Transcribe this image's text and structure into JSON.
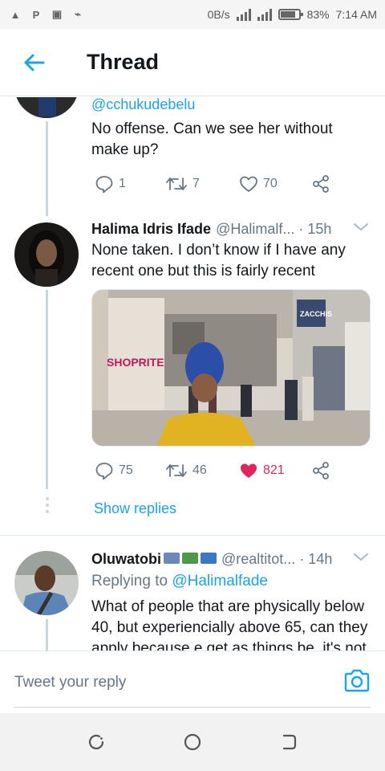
{
  "status_bar": {
    "speed": "0B/s",
    "battery": "83%",
    "time": "7:14 AM"
  },
  "header": {
    "title": "Thread"
  },
  "tweets": [
    {
      "username_link": "@cchukudebelu",
      "text": "No offense. Can we see her without make up?",
      "replies": "1",
      "retweets": "7",
      "likes": "70"
    },
    {
      "name": "Halima Idris Ifade",
      "handle": "@Halimalf...",
      "time": "· 15h",
      "text": "None taken. I don’t know if I have any recent one but this is fairly recent",
      "media_caption": "SHOPRITE",
      "media_sign": "ZACCHIS",
      "replies": "75",
      "retweets": "46",
      "likes": "821"
    },
    {
      "name": "Oluwatobi",
      "handle": "@realtitot...",
      "time": "· 14h",
      "replying_label": "Replying to",
      "replying_to": "@Halimalfade",
      "text": "What of people that are physically below 40, but experiencially above 65, can they apply because e get as things be, it's not"
    }
  ],
  "show_replies": "Show replies",
  "composer": {
    "placeholder": "Tweet your reply"
  },
  "colors": {
    "accent": "#1da1f2",
    "like": "#e0245e",
    "muted": "#657786"
  }
}
